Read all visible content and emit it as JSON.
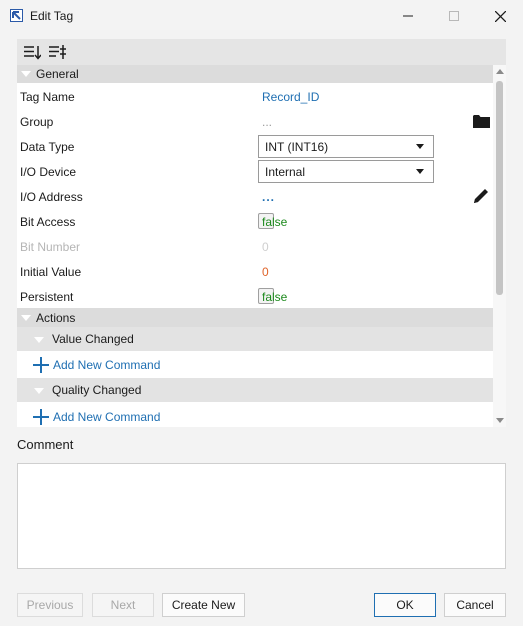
{
  "window": {
    "title": "Edit Tag"
  },
  "toolbar": {
    "icons": [
      "sort-by-category-icon",
      "sort-alphabetical-icon"
    ]
  },
  "grid": {
    "general_header": "General",
    "rows": {
      "tag_name": {
        "label": "Tag Name",
        "value": "Record_ID"
      },
      "group": {
        "label": "Group",
        "value": "..."
      },
      "data_type": {
        "label": "Data Type",
        "value": "INT (INT16)"
      },
      "io_device": {
        "label": "I/O Device",
        "value": "Internal"
      },
      "io_address": {
        "label": "I/O Address",
        "value": "..."
      },
      "bit_access": {
        "label": "Bit Access",
        "value": "false"
      },
      "bit_number": {
        "label": "Bit Number",
        "value": "0"
      },
      "initial_value": {
        "label": "Initial Value",
        "value": "0"
      },
      "persistent": {
        "label": "Persistent",
        "value": "false"
      }
    },
    "actions_header": "Actions",
    "value_changed_header": "Value Changed",
    "value_changed_command": "Add New Command",
    "quality_changed_header": "Quality Changed",
    "quality_changed_command": "Add New Command"
  },
  "comment": {
    "label": "Comment",
    "value": ""
  },
  "buttons": {
    "previous": "Previous",
    "next": "Next",
    "create_new": "Create New",
    "ok": "OK",
    "cancel": "Cancel"
  },
  "colors": {
    "link": "#1f6fb2",
    "bool": "#1d8a1d",
    "initial_value": "#e0642a",
    "section_bg": "#dcdcdc"
  }
}
